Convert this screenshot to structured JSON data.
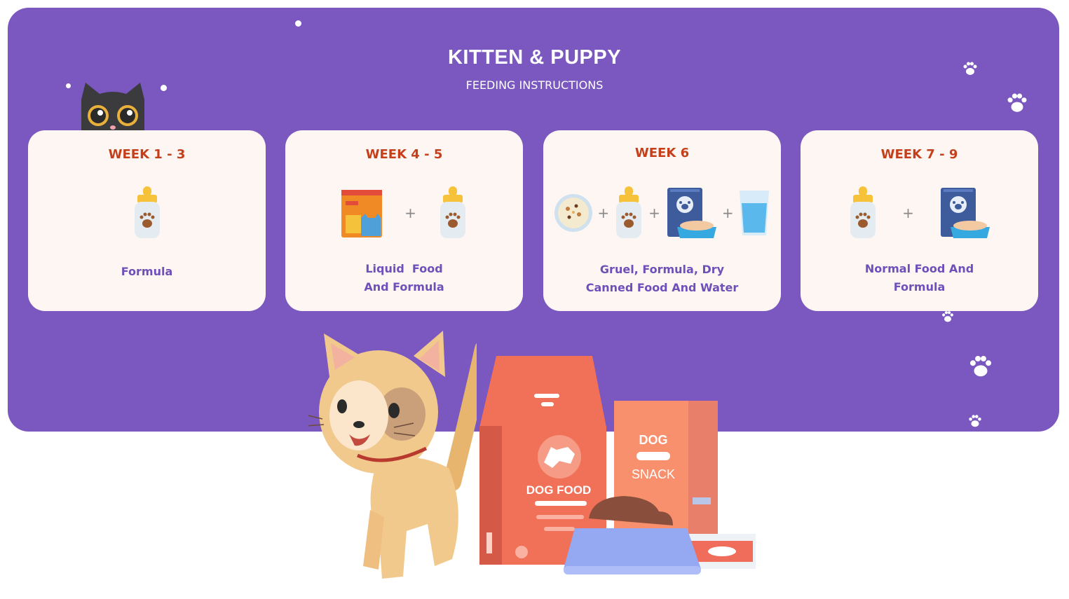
{
  "header": {
    "title": "KITTEN & PUPPY",
    "subtitle": "FEEDING INSTRUCTIONS"
  },
  "cards": [
    {
      "week": "WEEK 1 - 3",
      "label_line1": "Formula",
      "label_line2": "",
      "icons": [
        "baby-bottle-icon"
      ]
    },
    {
      "week": "WEEK 4 - 5",
      "label_line1": "Liquid  Food",
      "label_line2": "And Formula",
      "icons": [
        "food-bag-icon",
        "baby-bottle-icon"
      ]
    },
    {
      "week": "WEEK 6",
      "label_line1": "Gruel, Formula, Dry",
      "label_line2": "Canned Food And Water",
      "icons": [
        "gruel-bowl-icon",
        "baby-bottle-icon",
        "food-bag-bowl-icon",
        "water-glass-icon"
      ]
    },
    {
      "week": "WEEK 7 - 9",
      "label_line1": "Normal Food And",
      "label_line2": "Formula",
      "icons": [
        "baby-bottle-icon",
        "food-bag-bowl-icon"
      ]
    }
  ],
  "plus_sign": "+",
  "products": {
    "bag_label": "DOG FOOD",
    "snack_line1": "DOG",
    "snack_line2": "SNACK"
  },
  "colors": {
    "banner": "#7a58bf",
    "card_bg": "#fdf6f3",
    "week_text": "#c5401a",
    "label_text": "#6f4fb9"
  }
}
